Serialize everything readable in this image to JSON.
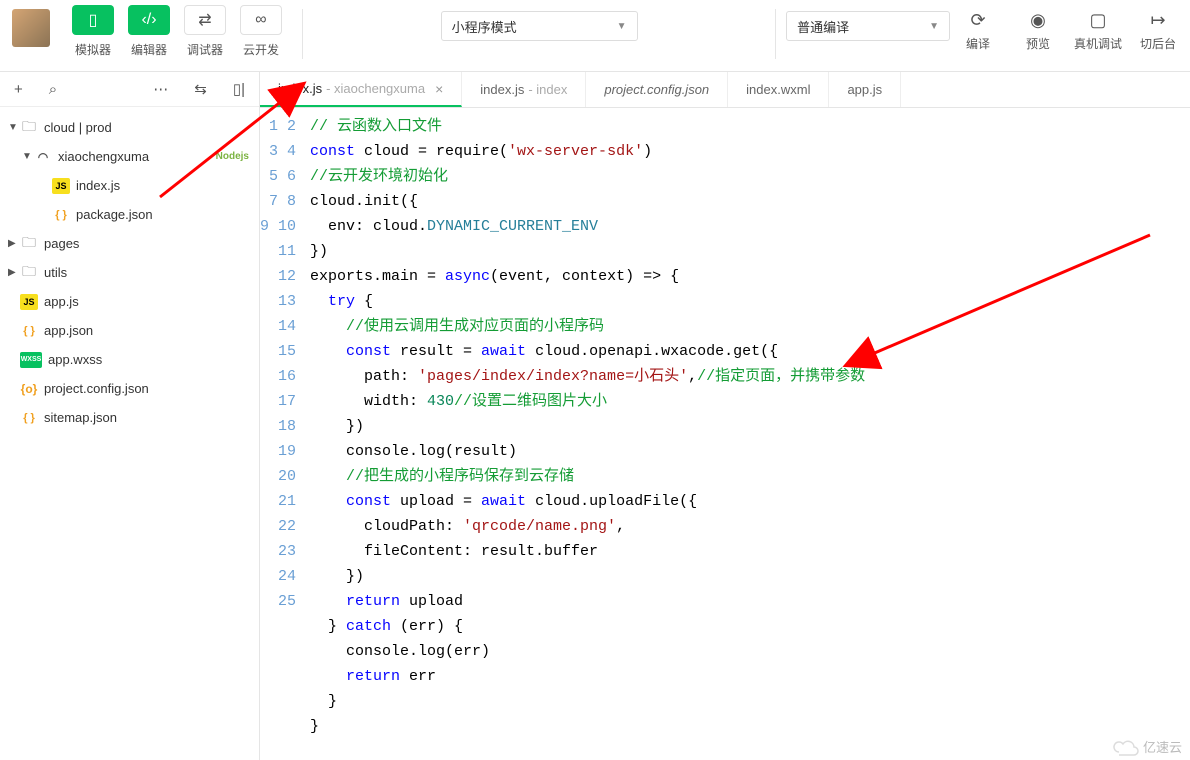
{
  "toolbar": {
    "simulator": "模拟器",
    "editor": "编辑器",
    "debugger": "调试器",
    "cloud_dev": "云开发",
    "mode_select": "小程序模式",
    "compile_select": "普通编译",
    "compile": "编译",
    "preview": "预览",
    "remote_debug": "真机调试",
    "switch_bg": "切后台"
  },
  "sidebar": {
    "tree": {
      "root": "cloud | prod",
      "folder1": "xiaochengxuma",
      "node_badge": "Nodejs",
      "file1": "index.js",
      "file2": "package.json",
      "folder2": "pages",
      "folder3": "utils",
      "file3": "app.js",
      "file4": "app.json",
      "file5": "app.wxss",
      "file6": "project.config.json",
      "file7": "sitemap.json"
    }
  },
  "tabs": [
    {
      "name": "index.js",
      "sub": "- xiaochengxuma",
      "active": true,
      "close": true
    },
    {
      "name": "index.js",
      "sub": "- index"
    },
    {
      "name": "project.config.json",
      "italic": true
    },
    {
      "name": "index.wxml"
    },
    {
      "name": "app.js"
    }
  ],
  "code": {
    "line1_c": "// 云函数入口文件",
    "line2_a": "const",
    "line2_b": " cloud = require(",
    "line2_c": "'wx-server-sdk'",
    "line2_d": ")",
    "line3_c": "//云开发环境初始化",
    "line4": "cloud.init({",
    "line5_a": "  env: cloud.",
    "line5_b": "DYNAMIC_CURRENT_ENV",
    "line6": "})",
    "line7_a": "exports.main = ",
    "line7_b": "async",
    "line7_c": "(event, context) => {",
    "line8_a": "  ",
    "line8_b": "try",
    "line8_c": " {",
    "line9_c": "    //使用云调用生成对应页面的小程序码",
    "line10_a": "    ",
    "line10_b": "const",
    "line10_c": " result = ",
    "line10_d": "await",
    "line10_e": " cloud.openapi.wxacode.get({",
    "line11_a": "      path: ",
    "line11_b": "'pages/index/index?name=小石头'",
    "line11_c": ",",
    "line11_d": "//指定页面，并携带参数",
    "line12_a": "      width: ",
    "line12_b": "430",
    "line12_c": "//设置二维码图片大小",
    "line13": "    })",
    "line14": "    console.log(result)",
    "line15_c": "    //把生成的小程序码保存到云存储",
    "line16_a": "    ",
    "line16_b": "const",
    "line16_c": " upload = ",
    "line16_d": "await",
    "line16_e": " cloud.uploadFile({",
    "line17_a": "      cloudPath: ",
    "line17_b": "'qrcode/name.png'",
    "line17_c": ",",
    "line18": "      fileContent: result.buffer",
    "line19": "    })",
    "line20_a": "    ",
    "line20_b": "return",
    "line20_c": " upload",
    "line21_a": "  } ",
    "line21_b": "catch",
    "line21_c": " (err) {",
    "line22": "    console.log(err)",
    "line23_a": "    ",
    "line23_b": "return",
    "line23_c": " err",
    "line24": "  }",
    "line25": "}"
  },
  "watermark": "亿速云"
}
